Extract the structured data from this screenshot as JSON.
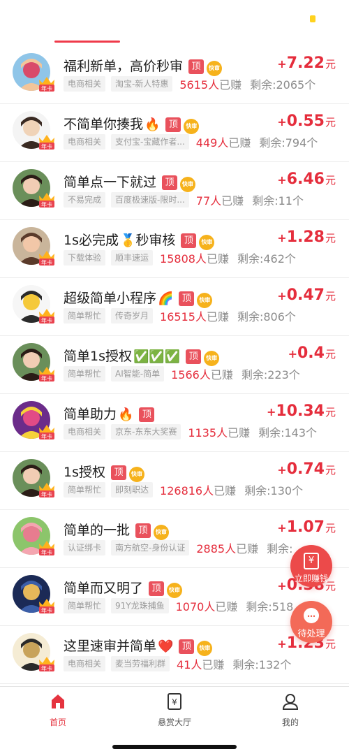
{
  "header": {
    "active_indicator_color": "#ef3a4a"
  },
  "badges": {
    "top": "顶",
    "fast": "快审",
    "annual": "年卡"
  },
  "tasks": [
    {
      "title": "福利新单，高价秒审",
      "emoji": "",
      "has_top": true,
      "has_fast": true,
      "plus": "+",
      "amount": "7.22",
      "unit": "元",
      "category": "电商相关",
      "source": "淘宝-新人特惠",
      "earned_count": "5615人",
      "earned_label": "已赚",
      "remaining": "剩余:2065个",
      "avatar_icon": "girl-photo-icon"
    },
    {
      "title": "不简单你揍我",
      "emoji": "🔥",
      "has_top": true,
      "has_fast": true,
      "plus": "+",
      "amount": "0.55",
      "unit": "元",
      "category": "电商相关",
      "source": "支付宝-宝藏作者...",
      "earned_count": "449人",
      "earned_label": "已赚",
      "remaining": "剩余:794个",
      "avatar_icon": "cartoon-boy-icon"
    },
    {
      "title": "简单点一下就过",
      "emoji": "",
      "has_top": true,
      "has_fast": true,
      "plus": "+",
      "amount": "6.46",
      "unit": "元",
      "category": "不易完成",
      "source": "百度极速版-限时...",
      "earned_count": "77人",
      "earned_label": "已赚",
      "remaining": "剩余:11个",
      "avatar_icon": "woman-photo-icon"
    },
    {
      "title": "1s必完成",
      "emoji": "🥇",
      "title_suffix": "秒审核",
      "has_top": true,
      "has_fast": true,
      "plus": "+",
      "amount": "1.28",
      "unit": "元",
      "category": "下载体验",
      "source": "顺丰速运",
      "earned_count": "15808人",
      "earned_label": "已赚",
      "remaining": "剩余:462个",
      "avatar_icon": "child-photo-icon"
    },
    {
      "title": "超级简单小程序",
      "emoji": "🌈",
      "has_top": true,
      "has_fast": true,
      "plus": "+",
      "amount": "0.47",
      "unit": "元",
      "category": "简单帮忙",
      "source": "传奇岁月",
      "earned_count": "16515人",
      "earned_label": "已赚",
      "remaining": "剩余:806个",
      "avatar_icon": "today-promo-icon"
    },
    {
      "title": "简单1s授权",
      "emoji": "✅✅✅",
      "has_top": true,
      "has_fast": true,
      "plus": "+",
      "amount": "0.4",
      "unit": "元",
      "category": "简单帮忙",
      "source": "AI智能-简单",
      "earned_count": "1566人",
      "earned_label": "已赚",
      "remaining": "剩余:223个",
      "avatar_icon": "woman-photo-icon"
    },
    {
      "title": "简单助力",
      "emoji": "🔥",
      "has_top": true,
      "has_fast": false,
      "plus": "+",
      "amount": "10.34",
      "unit": "元",
      "category": "电商相关",
      "source": "京东-东东大奖赛",
      "earned_count": "1135人",
      "earned_label": "已赚",
      "remaining": "剩余:143个",
      "avatar_icon": "shop-recommend-icon"
    },
    {
      "title": "1s授权",
      "emoji": "",
      "has_top": true,
      "has_fast": true,
      "plus": "+",
      "amount": "0.74",
      "unit": "元",
      "category": "简单帮忙",
      "source": "即刻职达",
      "earned_count": "126816人",
      "earned_label": "已赚",
      "remaining": "剩余:130个",
      "avatar_icon": "woman-photo-icon"
    },
    {
      "title": "简单的一批",
      "emoji": "",
      "has_top": true,
      "has_fast": true,
      "plus": "+",
      "amount": "1.07",
      "unit": "元",
      "category": "认证绑卡",
      "source": "南方航空-身份认证",
      "earned_count": "2885人",
      "earned_label": "已赚",
      "remaining": "剩余:",
      "avatar_icon": "pig-cartoon-icon"
    },
    {
      "title": "简单而又明了",
      "emoji": "",
      "has_top": true,
      "has_fast": true,
      "plus": "+",
      "amount": "0.38",
      "unit": "元",
      "category": "简单帮忙",
      "source": "91Y龙珠捕鱼",
      "earned_count": "1070人",
      "earned_label": "已赚",
      "remaining": "剩余:518",
      "avatar_icon": "night-sky-icon"
    },
    {
      "title": "这里速审并简单",
      "emoji": "❤️",
      "has_top": true,
      "has_fast": true,
      "plus": "+",
      "amount": "1.23",
      "unit": "元",
      "category": "电商相关",
      "source": "麦当劳福利群",
      "earned_count": "41人",
      "earned_label": "已赚",
      "remaining": "剩余:132个",
      "avatar_icon": "calligraphy-icon"
    }
  ],
  "floating": {
    "earn_label": "立即赚钱",
    "earn_icon": "¥",
    "pending_label": "待处理",
    "pending_icon": "…"
  },
  "tabbar": [
    {
      "label": "首页",
      "icon": "home-icon",
      "active": true
    },
    {
      "label": "悬赏大厅",
      "icon": "bounty-hall-icon",
      "active": false
    },
    {
      "label": "我的",
      "icon": "profile-icon",
      "active": false
    }
  ],
  "colors": {
    "accent": "#e52d3c",
    "top_badge": "#e9515c",
    "fast_badge": "#f6b21c",
    "chip_bg": "#f3f3f3"
  }
}
